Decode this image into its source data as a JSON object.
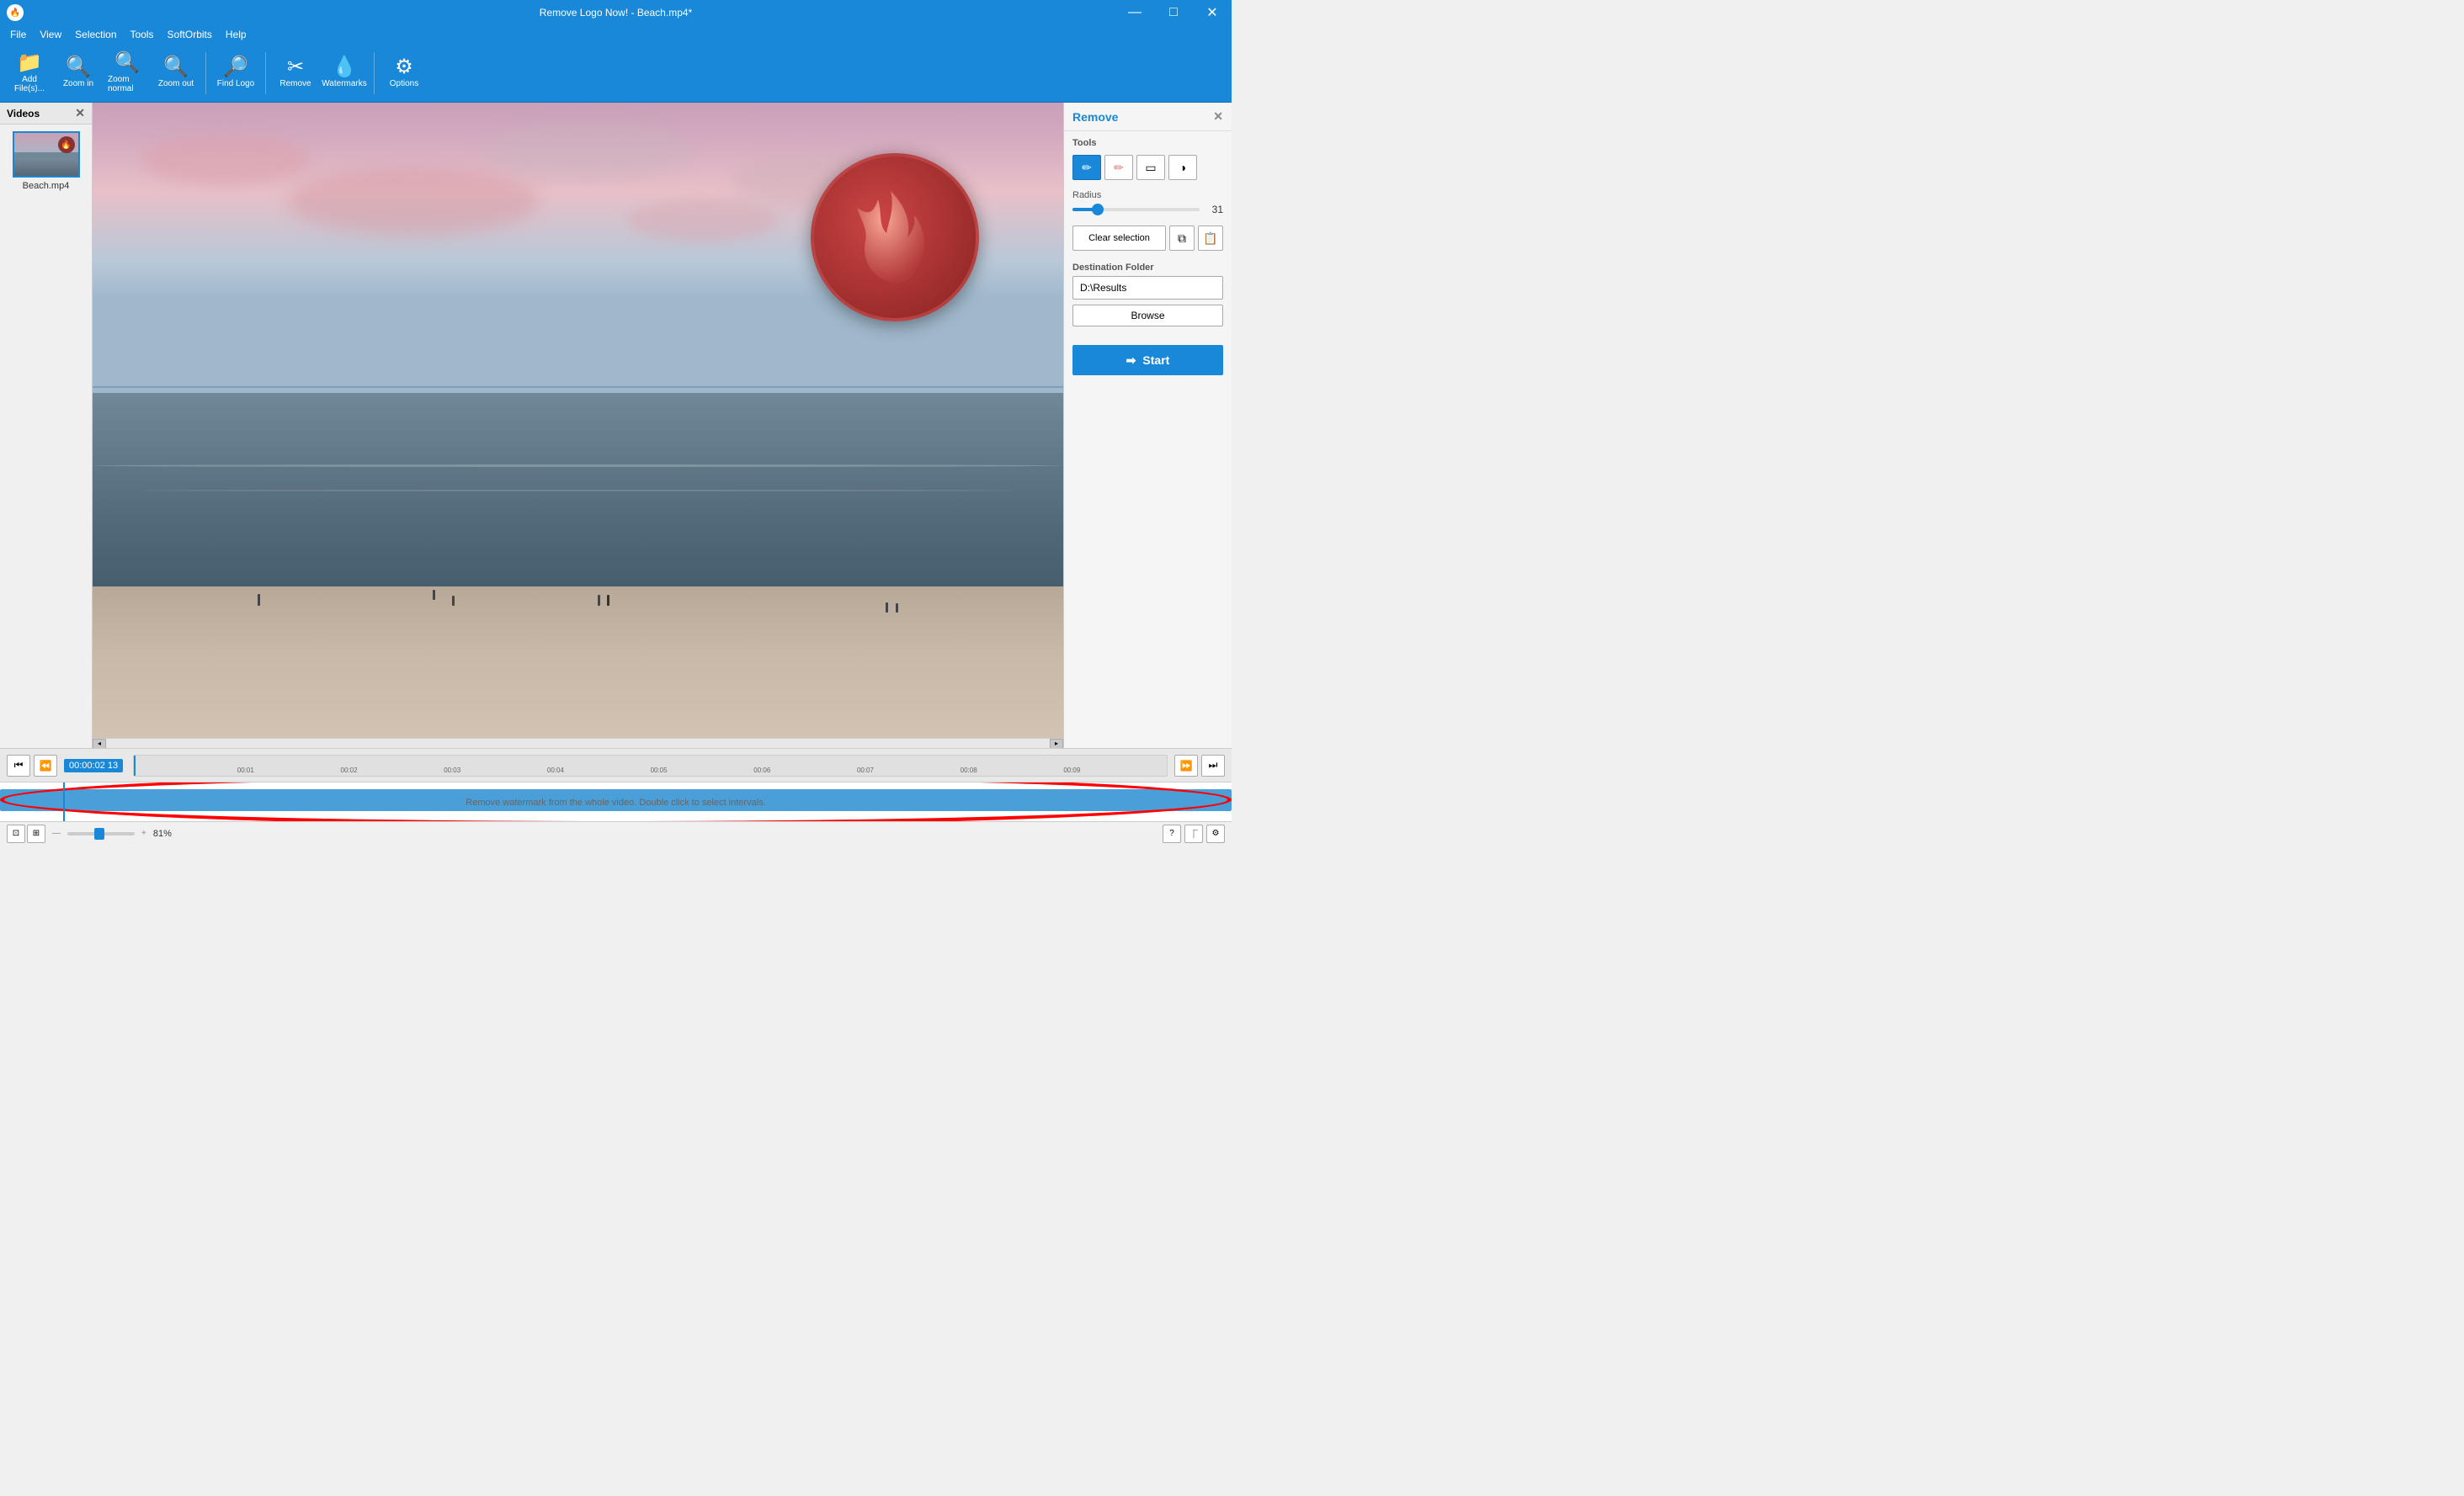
{
  "window": {
    "title": "Remove Logo Now! - Beach.mp4*",
    "app_icon": "🔥"
  },
  "title_bar": {
    "minimize": "—",
    "maximize": "□",
    "close": "✕"
  },
  "menu": {
    "items": [
      "File",
      "View",
      "Selection",
      "Tools",
      "SoftOrbits",
      "Help"
    ]
  },
  "toolbar": {
    "buttons": [
      {
        "icon": "📁",
        "label": "Add\nFile(s)..."
      },
      {
        "icon": "🔍+",
        "label": "Zoom\nin"
      },
      {
        "icon": "🔍",
        "label": "Zoom\nnormal"
      },
      {
        "icon": "🔍-",
        "label": "Zoom\nout"
      },
      {
        "icon": "🔎",
        "label": "Find\nLogo"
      },
      {
        "icon": "✂",
        "label": "Remove"
      },
      {
        "icon": "💧",
        "label": "Watermarks"
      },
      {
        "icon": "⚙",
        "label": "Options"
      }
    ]
  },
  "left_panel": {
    "title": "Videos",
    "files": [
      {
        "name": "Beach.mp4"
      }
    ]
  },
  "video": {
    "filename": "Beach.mp4"
  },
  "right_panel": {
    "title": "Remove",
    "tools_label": "Tools",
    "tools": [
      {
        "name": "pencil",
        "icon": "✏",
        "active": true
      },
      {
        "name": "eraser",
        "icon": "🖌",
        "active": false
      },
      {
        "name": "rectangle",
        "icon": "▭",
        "active": false
      },
      {
        "name": "circle",
        "icon": "◷",
        "active": false
      }
    ],
    "radius_label": "Radius",
    "radius_value": 31,
    "radius_pct": 20,
    "clear_selection_label": "Clear selection",
    "copy_icon": "⧉",
    "paste_icon": "📋",
    "destination_folder_label": "Destination Folder",
    "destination_folder_value": "D:\\Results",
    "browse_label": "Browse",
    "start_label": "Start"
  },
  "timeline": {
    "time_display": "00:00:02 13",
    "hint_text": "Remove watermark from the whole video. Double click to select intervals.",
    "zoom_pct": "81%",
    "controls": {
      "to_start": "⏮",
      "prev_frame": "⏪",
      "play": "▶",
      "next_frame": "⏩",
      "to_end": "⏭"
    }
  },
  "status_bar": {
    "zoom": "81%"
  }
}
